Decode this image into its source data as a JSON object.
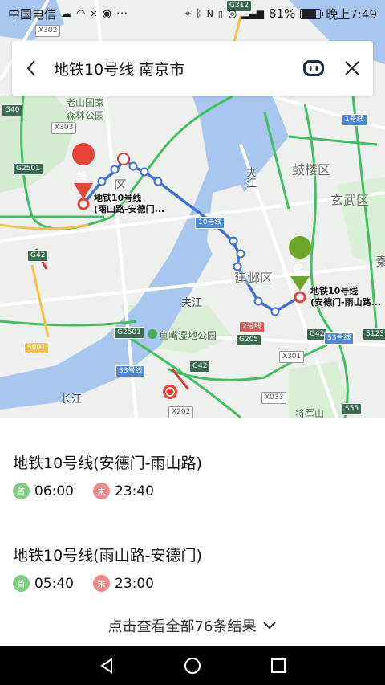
{
  "status_bar": {
    "carrier": "中国电信",
    "battery": "81%",
    "battery_level": 0.81,
    "time": "晚上7:49"
  },
  "search": {
    "query": "地铁10号线 南京市"
  },
  "map": {
    "poi": {
      "park": "老山国家\n森林公园",
      "wetland": "鱼嘴湿地公园",
      "mountain": "将军山"
    },
    "districts": {
      "gulou": "鼓楼区",
      "xuanwu": "玄武区",
      "jianye": "建邺区",
      "qin": "秦",
      "pukou_fragment": "区"
    },
    "water": {
      "river1": "长江",
      "river2": "夹江",
      "river3": "夹江",
      "river4": "长江"
    },
    "roads": {
      "x302": "X302",
      "x303": "X303",
      "g40": "G40",
      "g2501a": "G2501",
      "g42a": "G42",
      "g2501b": "G2501",
      "s001": "S001",
      "g42b": "G42",
      "x202": "X202",
      "x033": "X033",
      "x301": "X301",
      "g205": "G205",
      "g42c": "G42",
      "s123": "S123",
      "s55": "S55",
      "g312": "G312",
      "s3a": "S3号线",
      "s3b": "S3号线",
      "line1": "1号线",
      "line2": "2号线",
      "line10": "10号线"
    },
    "start_marker": "起",
    "end_marker": "终",
    "start_label": "地铁10号线\n(安德门-雨山路...",
    "end_label": "地铁10号线\n(雨山路-安德门..."
  },
  "routes": [
    {
      "title": "地铁10号线(安德门-雨山路)",
      "first_tag": "首",
      "first_time": "06:00",
      "last_tag": "末",
      "last_time": "23:40"
    },
    {
      "title": "地铁10号线(雨山路-安德门)",
      "first_tag": "首",
      "first_time": "05:40",
      "last_tag": "末",
      "last_time": "23:00"
    }
  ],
  "more_results": "点击查看全部76条结果",
  "colors": {
    "route_blue": "#3f6fd8",
    "start_green": "#6aa728",
    "end_red": "#e8443a",
    "water": "#a8c6ee",
    "park_green": "#cfe8cc"
  }
}
